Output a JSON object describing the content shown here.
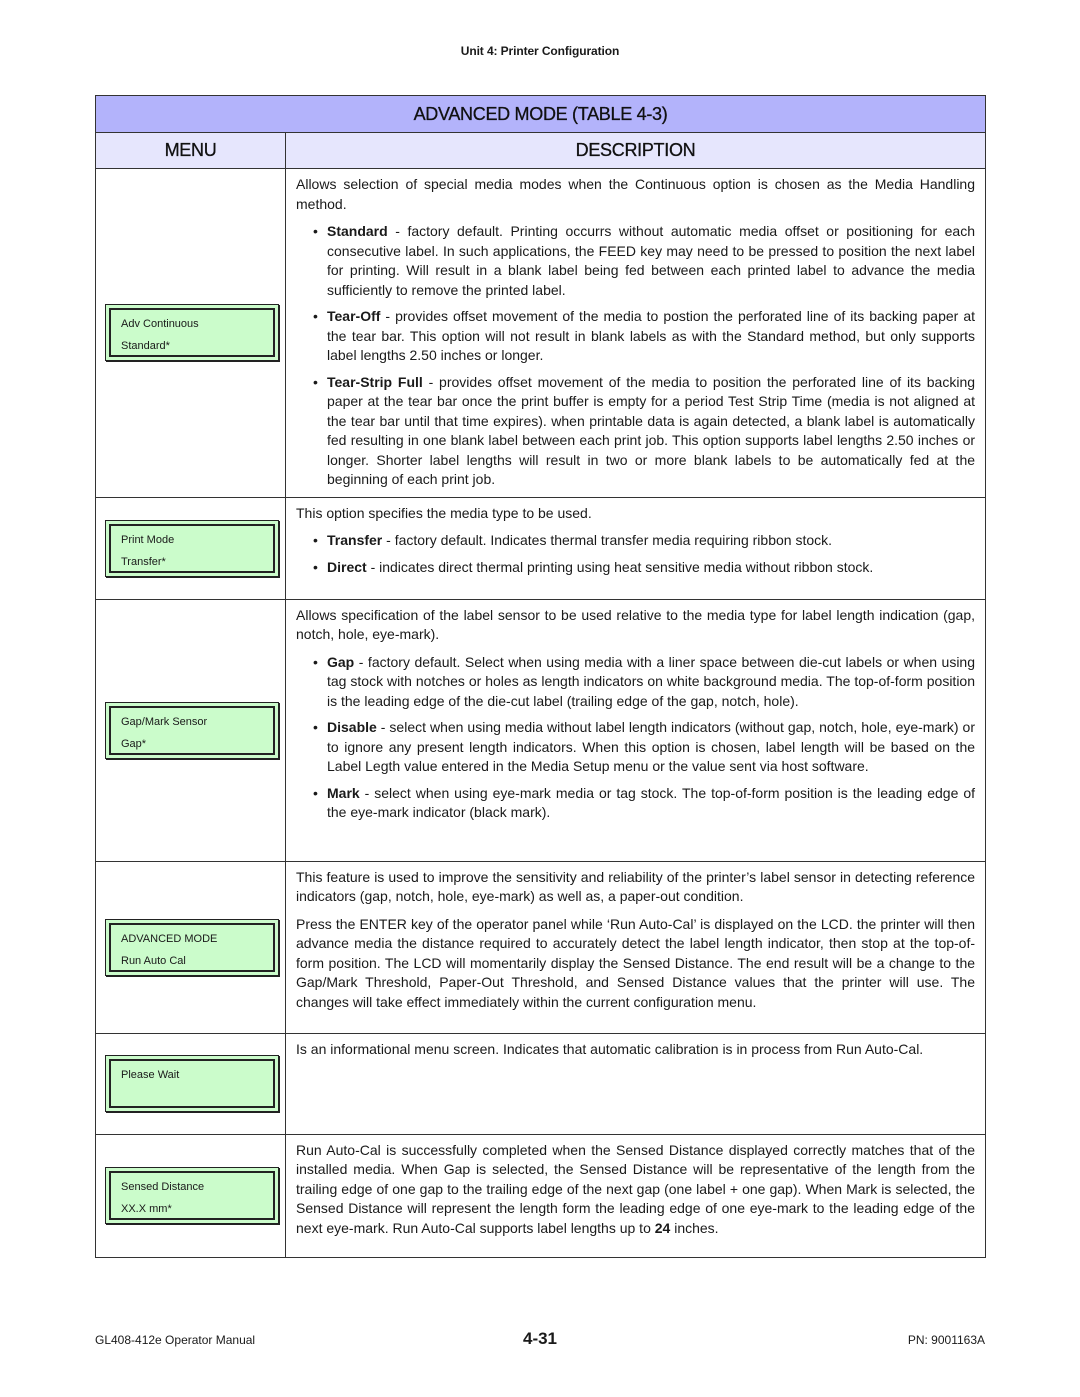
{
  "header": {
    "running_title": "Unit 4:  Printer Configuration"
  },
  "table": {
    "title": "ADVANCED MODE (TABLE 4-3)",
    "columns": {
      "menu": "MENU",
      "description": "DESCRIPTION"
    },
    "rows": [
      {
        "lcd": [
          "Adv Continuous",
          "Standard*"
        ],
        "intro": "Allows selection of special media modes when the Continuous option is chosen as the Media Handling method.",
        "bullets": [
          {
            "term": "Standard",
            "text": " - factory default. Printing occurrs without automatic media offset or positioning for each consecutive label. In such applications, the FEED key may need to be pressed to position the next label for printing. Will result in a blank label being fed between each printed label to advance the media sufficiently to remove the printed label."
          },
          {
            "term": "Tear-Off",
            "text": " -  provides offset movement of the media to postion the perforated line of its backing paper at the tear bar. This option will not result in blank labels as with the Standard method, but only supports label lengths 2.50 inches or longer."
          },
          {
            "term": "Tear-Strip Full",
            "text": " - provides offset movement of the media to position the perforated line of its backing paper at the tear bar once the print buffer is empty for a period Test Strip Time (media is not aligned at the tear bar until that time expires). when printable data is again detected, a blank label is automatically fed resulting in one blank label between each print job. This option supports label lengths 2.50 inches or longer. Shorter label lengths will result in two or more blank labels to be automatically fed at the beginning of each print job."
          }
        ]
      },
      {
        "lcd": [
          "Print Mode",
          "Transfer*"
        ],
        "intro": "This option specifies the media type to be used.",
        "bullets": [
          {
            "term": "Transfer",
            "text": " - factory default. Indicates thermal transfer media requiring ribbon stock."
          },
          {
            "term": "Direct",
            "text": " -  indicates direct thermal printing using heat sensitive media without ribbon stock."
          }
        ]
      },
      {
        "lcd": [
          "Gap/Mark Sensor",
          "Gap*"
        ],
        "intro": "Allows specification of the label sensor to be used relative to the media type for label length indication (gap, notch, hole, eye-mark).",
        "bullets": [
          {
            "term": "Gap",
            "text": " - factory default. Select when using media with a liner space between die-cut labels or when using tag stock with notches or holes as length indicators on white background media. The top-of-form position is the leading edge of the die-cut label (trailing edge of the gap, notch, hole)."
          },
          {
            "term": "Disable",
            "text": " -  select when using media without label length indicators (without gap, notch, hole, eye-mark) or to ignore any present length indicators. When this option is chosen, label length will be based on the Label Legth value entered in the Media Setup menu or the value sent via host software."
          },
          {
            "term": "Mark",
            "text": " - select when using eye-mark media or tag stock. The top-of-form position is the leading edge of the eye-mark indicator (black mark)."
          }
        ]
      },
      {
        "lcd": [
          "ADVANCED MODE",
          "Run Auto Cal"
        ],
        "paragraphs": [
          "This feature is used to improve the sensitivity and reliability of the printer’s label sensor in detecting reference indicators (gap, notch, hole, eye-mark) as well as, a paper-out condition.",
          "Press the ENTER key of the operator panel while ‘Run Auto-Cal’ is displayed on the LCD. the printer will then advance media the distance required to accurately detect the label length indicator, then stop at the top-of-form position. The LCD will momentarily display the Sensed Distance. The end result will be a change to the Gap/Mark Threshold, Paper-Out Threshold, and Sensed Distance values that the printer will use. The changes will take effect immediately within the current configuration menu."
        ]
      },
      {
        "lcd": [
          "Please Wait",
          ""
        ],
        "paragraphs": [
          "Is an informational menu screen. Indicates that automatic calibration is in process from Run Auto-Cal."
        ]
      },
      {
        "lcd": [
          "Sensed Distance",
          "XX.X  mm*"
        ],
        "para_pre": "Run Auto-Cal is successfully completed when the Sensed Distance displayed correctly matches that of the installed media. When Gap is selected, the Sensed Distance will be representative of the length from the trailing edge of one gap to the trailing edge of the next gap (one label + one gap). When Mark is selected, the Sensed Distance will represent the length form the leading edge of one eye-mark to the leading edge of the next eye-mark. Run Auto-Cal supports label lengths up to ",
        "para_bold": "24",
        "para_post": " inches."
      }
    ]
  },
  "footer": {
    "manual": "GL408-412e Operator Manual",
    "page": "4-31",
    "part_number": "PN: 9001163A"
  },
  "colors": {
    "title_bar": "#b3b3fb",
    "header_bar": "#e6e6fd",
    "lcd_background": "#cbfccb"
  },
  "bullet_glyph": "•"
}
